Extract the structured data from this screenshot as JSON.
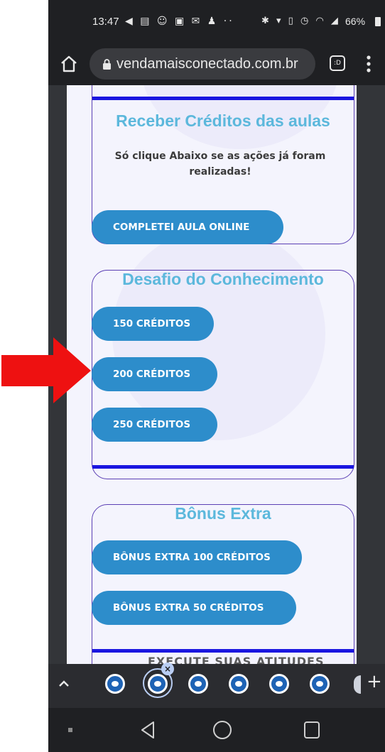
{
  "status_bar": {
    "time": "13:47",
    "left_icons": "◀ ▤ ☺ ▣ ✉ ♟ ··",
    "right_icons": "✱ ▾ ▯ ◷ ◠ ◢",
    "battery": "66%"
  },
  "browser": {
    "url": "vendamaisconectado.com.br",
    "tab_icon_label": ":D"
  },
  "card_receber": {
    "title": "Receber Créditos das aulas",
    "text": "Só clique Abaixo se as ações já foram realizadas!",
    "button": "COMPLETEI AULA ONLINE"
  },
  "card_desafio": {
    "title": "Desafio do Conhecimento",
    "buttons": [
      "150 CRÉDITOS",
      "200 CRÉDITOS",
      "250 CRÉDITOS"
    ]
  },
  "card_bonus": {
    "title": "Bônus Extra",
    "buttons": [
      "BÔNUS EXTRA 100 CRÉDITOS",
      "BÔNUS EXTRA 50 CRÉDITOS"
    ]
  },
  "behind_text": "EXECUTE SUAS ATITUDES",
  "tab_strip": {
    "close_symbol": "×",
    "add_symbol": "+"
  },
  "colors": {
    "button_blue": "#2d8dcb",
    "title_blue": "#5cb8dc",
    "card_border": "#5b3fb4",
    "divider_line": "#1a16e0",
    "annotation_arrow": "#ee1111"
  },
  "icons": {
    "annotation": "red-arrow-pointing-right"
  }
}
